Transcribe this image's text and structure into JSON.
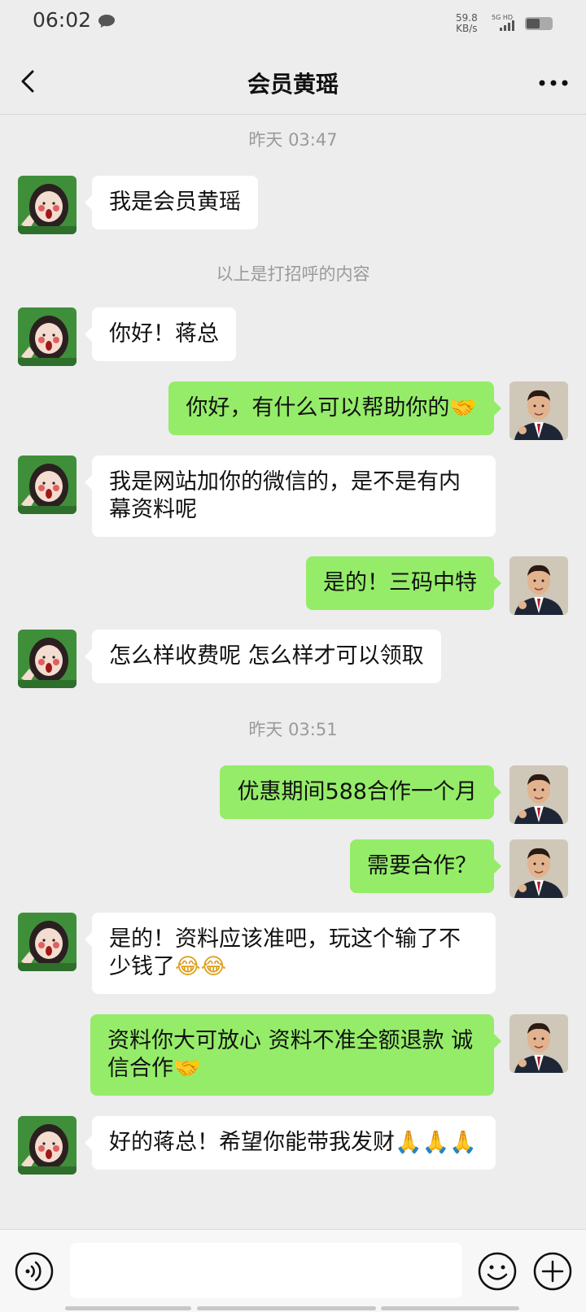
{
  "status_bar": {
    "time": "06:02",
    "speed_value": "59.8",
    "speed_unit": "KB/s",
    "network": "5G HD"
  },
  "nav": {
    "title": "会员黄瑶"
  },
  "messages": [
    {
      "type": "time",
      "text": "昨天 03:47"
    },
    {
      "type": "in",
      "text": "我是会员黄瑶"
    },
    {
      "type": "system",
      "text": "以上是打招呼的内容"
    },
    {
      "type": "in",
      "text": "你好！蒋总"
    },
    {
      "type": "out",
      "text": "你好，有什么可以帮助你的",
      "emoji": "🤝"
    },
    {
      "type": "in",
      "text": "我是网站加你的微信的，是不是有内幕资料呢"
    },
    {
      "type": "out",
      "text": "是的！三码中特"
    },
    {
      "type": "in",
      "text": "怎么样收费呢 怎么样才可以领取"
    },
    {
      "type": "time",
      "text": "昨天 03:51"
    },
    {
      "type": "out",
      "text": "优惠期间588合作一个月"
    },
    {
      "type": "out",
      "text": "需要合作？"
    },
    {
      "type": "in",
      "text": "是的！资料应该准吧，玩这个输了不少钱了",
      "emoji": "😂😂"
    },
    {
      "type": "out",
      "text": "资料你大可放心 资料不准全额退款 诚信合作",
      "emoji": "🤝"
    },
    {
      "type": "in",
      "text": "好的蒋总！希望你能带我发财",
      "emoji": "🙏🙏🙏"
    }
  ],
  "input": {
    "placeholder": ""
  },
  "colors": {
    "background": "#ededed",
    "outgoing_bubble": "#95ec69",
    "incoming_bubble": "#ffffff"
  },
  "icons": {
    "back": "chevron-left-icon",
    "more": "more-dots-icon",
    "voice": "voice-icon",
    "emoji": "emoji-face-icon",
    "plus": "plus-icon"
  }
}
